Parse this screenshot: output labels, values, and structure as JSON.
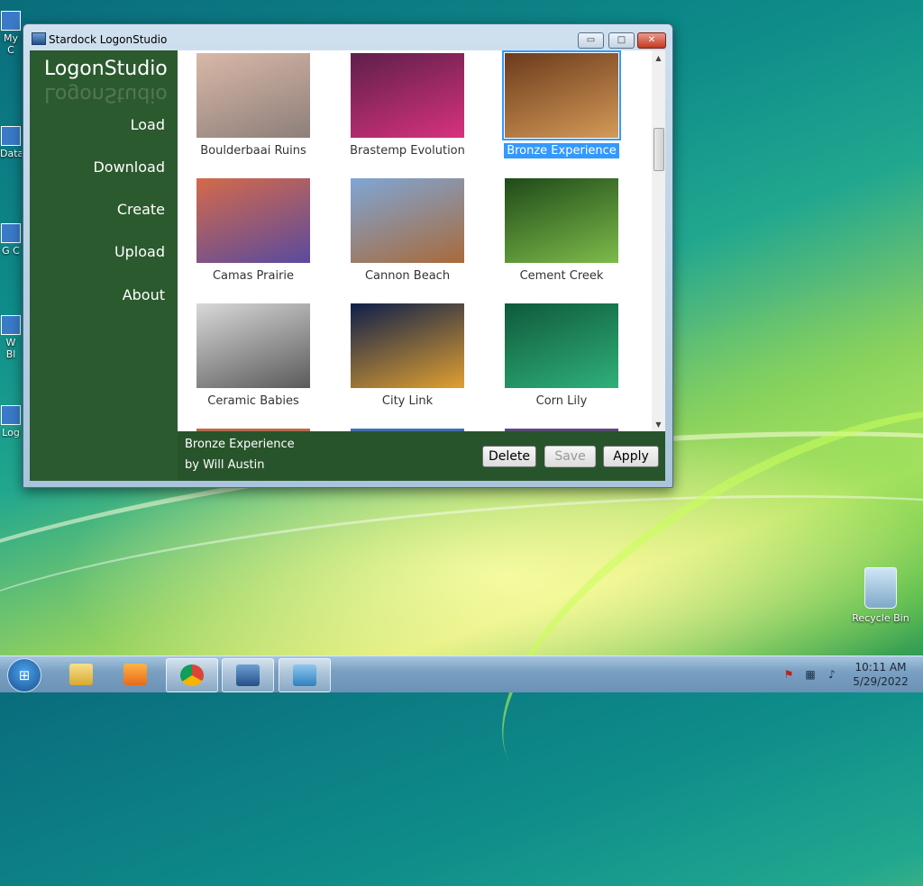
{
  "desktop": {
    "icons_left": [
      "My C",
      "Data",
      "G C",
      "W Bl",
      "Log"
    ],
    "recycle_bin": "Recycle Bin"
  },
  "window": {
    "title": "Stardock LogonStudio",
    "controls": {
      "minimize": "▭",
      "maximize": "□",
      "close": "✕"
    }
  },
  "sidebar": {
    "app_name": "LogonStudio",
    "nav": [
      "Load",
      "Download",
      "Create",
      "Upload",
      "About"
    ]
  },
  "gallery": {
    "items": [
      {
        "name": "Boulderbaai Ruins",
        "colors": [
          "#d9b8a8",
          "#8d7f7a"
        ]
      },
      {
        "name": "Brastemp Evolution",
        "colors": [
          "#5e1f4a",
          "#d7327d"
        ]
      },
      {
        "name": "Bronze Experience",
        "colors": [
          "#6b3a1b",
          "#d49a58"
        ],
        "selected": true
      },
      {
        "name": "Camas Prairie",
        "colors": [
          "#d46a4a",
          "#5a4a9e"
        ]
      },
      {
        "name": "Cannon Beach",
        "colors": [
          "#7fa6d6",
          "#a86a3a"
        ]
      },
      {
        "name": "Cement Creek",
        "colors": [
          "#1f4a18",
          "#7dbb4a"
        ]
      },
      {
        "name": "Ceramic Babies",
        "colors": [
          "#d8d8d8",
          "#5a5a5a"
        ]
      },
      {
        "name": "City Link",
        "colors": [
          "#0e1f4a",
          "#e0a030"
        ]
      },
      {
        "name": "Corn Lily",
        "colors": [
          "#0f5a3a",
          "#2fb07a"
        ]
      }
    ]
  },
  "footer": {
    "selected_name": "Bronze Experience",
    "selected_author": "by Will Austin",
    "delete_label": "Delete",
    "save_label": "Save",
    "apply_label": "Apply"
  },
  "taskbar": {
    "clock_time": "10:11 AM",
    "clock_date": "5/29/2022"
  }
}
